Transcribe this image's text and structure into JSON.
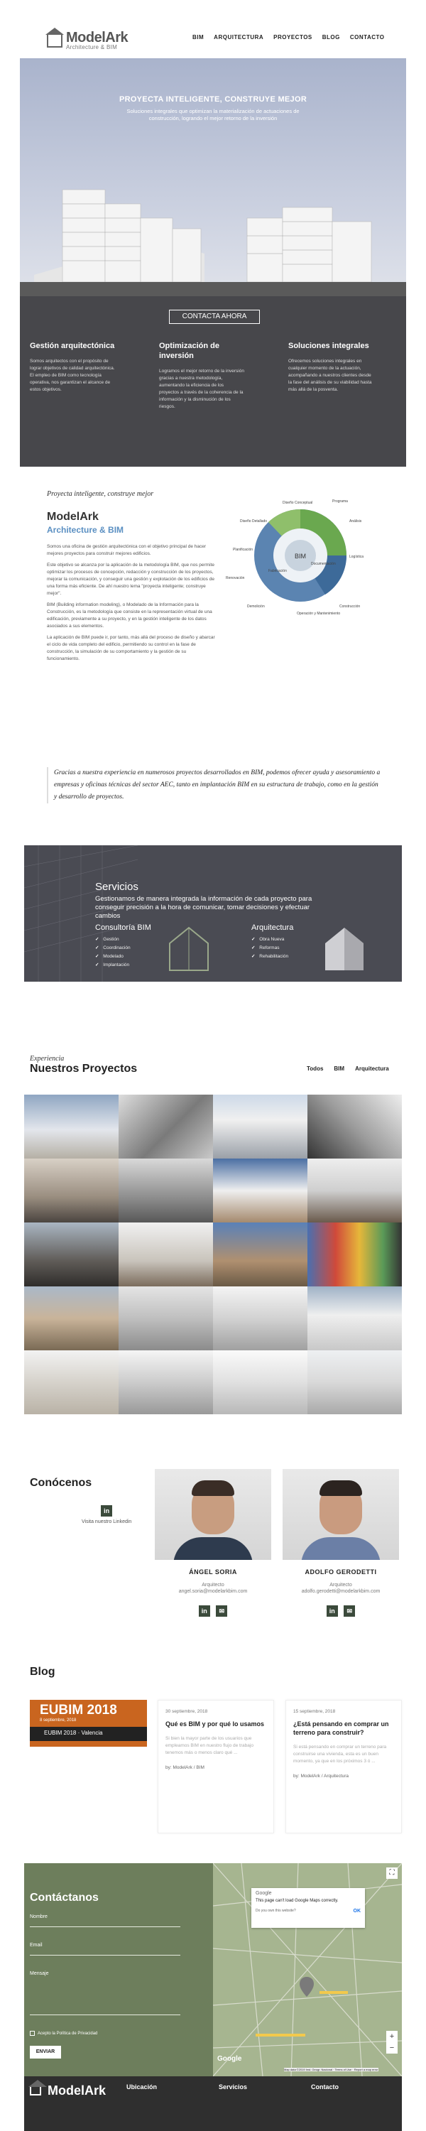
{
  "nav": {
    "brand": "ModelArk",
    "brand_sub": "Architecture & BIM",
    "items": [
      "BIM",
      "ARQUITECTURA",
      "PROYECTOS",
      "BLOG",
      "CONTACTO"
    ]
  },
  "hero": {
    "title": "PROYECTA INTELIGENTE, CONSTRUYE MEJOR",
    "subtitle": "Soluciones integrales que optimizan la materialización de actuaciones de construcción, logrando el mejor retorno de la inversión",
    "cta": "CONTACTA AHORA",
    "features": [
      {
        "title": "Gestión arquitectónica",
        "text": "Somos arquitectos con el propósito de lograr objetivos de calidad arquitectónica. El empleo de BIM como tecnología operativa, nos garantizan el alcance de estos objetivos."
      },
      {
        "title": "Optimización de inversión",
        "text": "Logramos el mejor retorno de la inversión gracias a nuestra metodología, aumentando la eficiencia de los proyectos a través de la coherencia de la información y la disminución de los riesgos."
      },
      {
        "title": "Soluciones integrales",
        "text": "Ofrecemos soluciones integrales en cualquier momento de la actuación, acompañando a nuestros clientes desde la fase del análisis de su viabilidad hasta más allá de la posventa."
      }
    ]
  },
  "about": {
    "tagline": "Proyecta inteligente, construye mejor",
    "title": "ModelArk",
    "subtitle": "Architecture & BIM",
    "paragraphs": [
      "Somos una oficina de gestión arquitectónica con el objetivo principal de hacer mejores proyectos para construir mejores edificios.",
      "Este objetivo se alcanza por la aplicación de la metodología BIM, que nos permite optimizar los procesos de concepción, redacción y construcción de los proyectos, mejorar la comunicación, y conseguir una gestión y explotación de los edificios de una forma más eficiente. De ahí nuestro lema \"proyecta inteligente; construye mejor\".",
      "BIM (Building information modeling), o Modelado de la Información para la Construcción, es la metodología que consiste en la representación virtual de una edificación, previamente a su proyecto, y en la gestión inteligente de los datos asociados a sus elementos.",
      "La aplicación de BIM puede ir, por tanto, más allá del proceso de diseño y abarcar el ciclo de vida completo del edificio, permitiendo su control en la fase de construcción, la simulación de su comportamiento y la gestión de su funcionamiento."
    ],
    "diagram_labels": [
      "Diseño Conceptual",
      "Análisis",
      "Planificación",
      "Diseño Detallado",
      "Documentación",
      "Fabricación",
      "Logística",
      "Construcción",
      "Operación y Mantenimiento",
      "Renovación",
      "Demolición",
      "Programa",
      "BIM"
    ],
    "quote": "Gracias a nuestra experiencia en numerosos proyectos desarrollados en BIM, podemos ofrecer ayuda y asesoramiento a empresas y oficinas técnicas del sector AEC, tanto en implantación BIM en su estructura de trabajo, como en la gestión y desarrollo de proyectos."
  },
  "services": {
    "title": "Servicios",
    "text": "Gestionamos de manera integrada la información de cada proyecto para conseguir precisión a la hora de comunicar, tomar decisiones y efectuar cambios",
    "columns": [
      {
        "title": "Consultoría BIM",
        "items": [
          "Gestión",
          "Coordinación",
          "Modelado",
          "Implantación"
        ]
      },
      {
        "title": "Arquitectura",
        "items": [
          "Obra Nueva",
          "Reformas",
          "Rehabilitación"
        ]
      }
    ]
  },
  "projects": {
    "tagline": "Experiencia",
    "title": "Nuestros Proyectos",
    "filters": [
      "Todos",
      "BIM",
      "Arquitectura"
    ]
  },
  "team": {
    "title": "Conócenos",
    "linkedin_label": "Visita nuestro Linkedin",
    "members": [
      {
        "name": "ÁNGEL SORIA",
        "role": "Arquitecto",
        "email": "angel.soria@modelarkbim.com"
      },
      {
        "name": "ADOLFO GERODETTI",
        "role": "Arquitecto",
        "email": "adolfo.gerodetti@modelarkbim.com"
      }
    ]
  },
  "blog": {
    "title": "Blog",
    "banner": {
      "title": "EUBIM 2018",
      "date": "8 septiembre, 2018",
      "sub": "EUBIM 2018 · Valencia"
    },
    "posts": [
      {
        "date": "30 septiembre, 2018",
        "title": "Qué es BIM y por qué lo usamos",
        "excerpt": "Si bien la mayor parte de los usuarios que empleamos BIM en nuestro flujo de trabajo tenemos más o menos claro qué ...",
        "by": "by: ModelArk / BIM"
      },
      {
        "date": "15 septiembre, 2018",
        "title": "¿Está pensando en comprar un terreno para construir?",
        "excerpt": "Si está pensando en comprar un terreno para construirse una vivienda, esta es un buen momento, ya que en los próximos 3 ó ...",
        "by": "by: ModelArk / Arquitectura"
      }
    ]
  },
  "contact": {
    "title": "Contáctanos",
    "fields": [
      "Nombre",
      "Email",
      "Mensaje"
    ],
    "privacy": "Acepto la Política de Privacidad",
    "send": "ENVIAR"
  },
  "map": {
    "dialog_title": "This page can't load Google Maps correctly.",
    "dialog_q": "Do you own this website?",
    "dialog_ok": "OK",
    "brand": "Google",
    "footer_text": "Map data ©2019 Inst. Geogr. Nacional · Terms of Use · Report a map error"
  },
  "footer": {
    "brand": "ModelArk",
    "cols": [
      "Ubicación",
      "Servicios",
      "Contacto"
    ]
  },
  "colors": {
    "accent_blue": "#5a8fc2",
    "green": "#6d7e5c",
    "dark": "#47474b"
  }
}
